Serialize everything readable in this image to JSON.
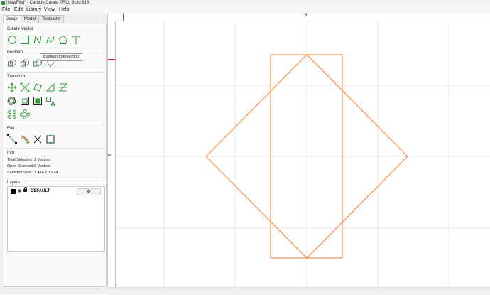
{
  "window": {
    "title": "[NewFile]* - Carbide Create PRO, Build 816"
  },
  "menu": [
    "File",
    "Edit",
    "Library",
    "View",
    "Help"
  ],
  "tabs": {
    "design": "Design",
    "model": "Model",
    "toolpaths": "Toolpaths"
  },
  "sections": {
    "create_vector": "Create Vector",
    "boolean": "Boolean",
    "transform": "Transform",
    "edit": "Edit",
    "info": "Info",
    "layers": "Layers"
  },
  "tooltip": "Boolean Intersection",
  "info": {
    "total_selected_label": "Total Selected:",
    "total_selected_value": "2 Vectors",
    "open_selected_label": "Open Selected:",
    "open_selected_value": "0 Vectors",
    "selected_size_label": "Selected Size:",
    "selected_size_value": "1.414 x 1.414"
  },
  "layers": [
    {
      "name": "DEFAULT",
      "color": "#000000"
    }
  ],
  "rulers": {
    "top_label": "6",
    "left_label": "6"
  },
  "colors": {
    "accent_green": "#2e9a3a",
    "vector_orange": "#ff7a22",
    "grid": "#e6e6e6"
  },
  "icons": {
    "create_vector": [
      "circle-icon",
      "rectangle-icon",
      "polyline-icon",
      "curve-icon",
      "polygon-icon",
      "text-icon"
    ],
    "boolean": [
      "boolean-union-icon",
      "boolean-subtract-icon",
      "boolean-intersection-icon",
      "boolean-weld-icon"
    ],
    "transform": [
      "move-icon",
      "scale-icon",
      "rotate-icon",
      "align-icon",
      "mirror-icon",
      "offset-icon",
      "fillet-icon",
      "nest-icon",
      "array-icon",
      "circular-array-icon"
    ],
    "edit": [
      "node-edit-icon",
      "trim-icon",
      "cut-icon",
      "join-icon"
    ]
  }
}
